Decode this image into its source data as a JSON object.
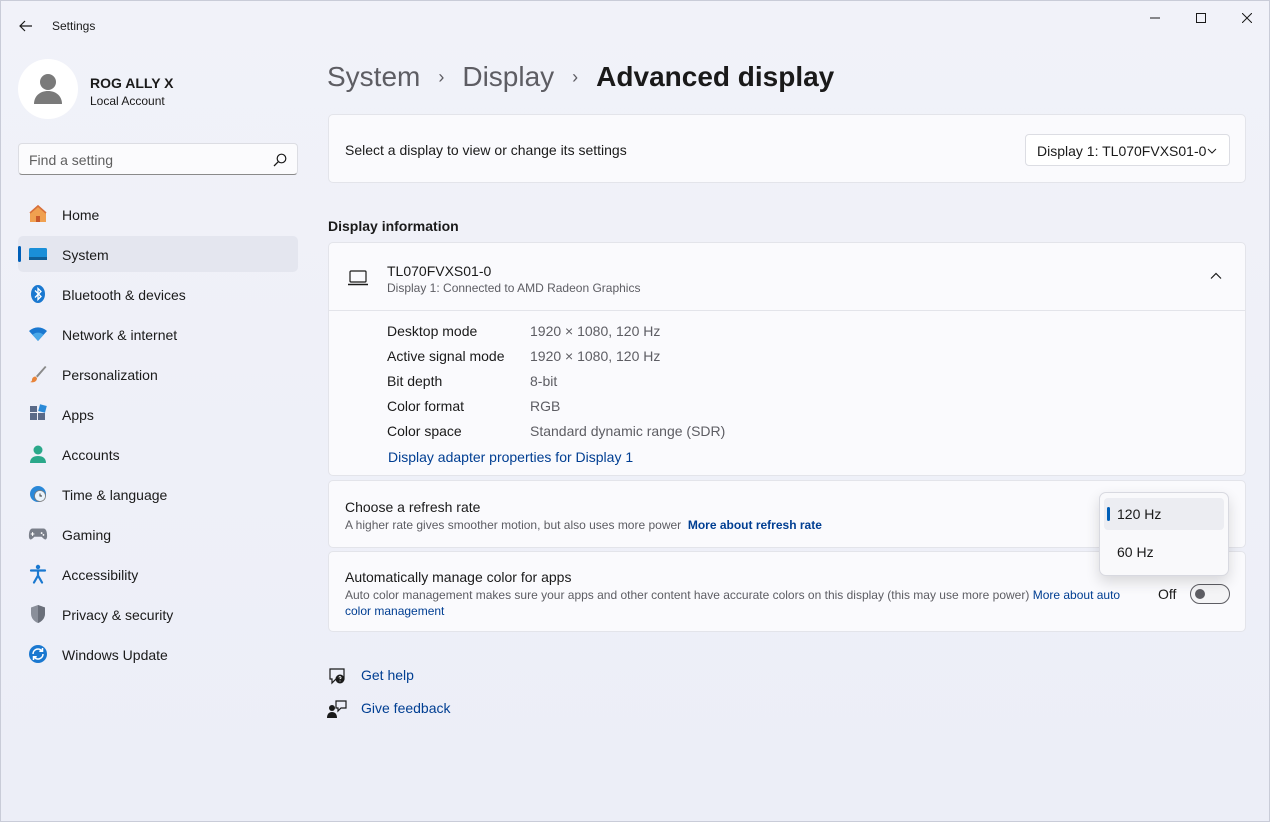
{
  "window": {
    "title": "Settings"
  },
  "profile": {
    "name": "ROG ALLY X",
    "account": "Local Account"
  },
  "search": {
    "placeholder": "Find a setting"
  },
  "sidebar": {
    "items": [
      {
        "label": "Home",
        "icon": "home-icon"
      },
      {
        "label": "System",
        "icon": "system-icon",
        "active": true
      },
      {
        "label": "Bluetooth & devices",
        "icon": "bluetooth-icon"
      },
      {
        "label": "Network & internet",
        "icon": "wifi-icon"
      },
      {
        "label": "Personalization",
        "icon": "brush-icon"
      },
      {
        "label": "Apps",
        "icon": "apps-icon"
      },
      {
        "label": "Accounts",
        "icon": "accounts-icon"
      },
      {
        "label": "Time & language",
        "icon": "clock-globe-icon"
      },
      {
        "label": "Gaming",
        "icon": "gamepad-icon"
      },
      {
        "label": "Accessibility",
        "icon": "accessibility-icon"
      },
      {
        "label": "Privacy & security",
        "icon": "shield-icon"
      },
      {
        "label": "Windows Update",
        "icon": "update-icon"
      }
    ]
  },
  "breadcrumb": {
    "level1": "System",
    "level2": "Display",
    "current": "Advanced display",
    "separator": "›"
  },
  "display_select": {
    "label": "Select a display to view or change its settings",
    "value": "Display 1: TL070FVXS01-0"
  },
  "display_info": {
    "heading": "Display information",
    "name": "TL070FVXS01-0",
    "connection": "Display 1: Connected to AMD Radeon Graphics",
    "rows": [
      {
        "label": "Desktop mode",
        "value": "1920 × 1080, 120 Hz"
      },
      {
        "label": "Active signal mode",
        "value": "1920 × 1080, 120 Hz"
      },
      {
        "label": "Bit depth",
        "value": "8-bit"
      },
      {
        "label": "Color format",
        "value": "RGB"
      },
      {
        "label": "Color space",
        "value": "Standard dynamic range (SDR)"
      }
    ],
    "adapter_link": "Display adapter properties for Display 1"
  },
  "refresh_rate": {
    "title": "Choose a refresh rate",
    "description": "A higher rate gives smoother motion, but also uses more power",
    "link": "More about refresh rate",
    "options": [
      "120 Hz",
      "60 Hz"
    ],
    "selected": "120 Hz"
  },
  "auto_color": {
    "title": "Automatically manage color for apps",
    "description": "Auto color management makes sure your apps and other content have accurate colors on this display (this may use more power)",
    "link_part1": "More about auto",
    "link_part2": "color management",
    "state": "Off"
  },
  "help": {
    "get_help": "Get help",
    "give_feedback": "Give feedback"
  },
  "colors": {
    "accent": "#005fb8",
    "link": "#003e92"
  }
}
